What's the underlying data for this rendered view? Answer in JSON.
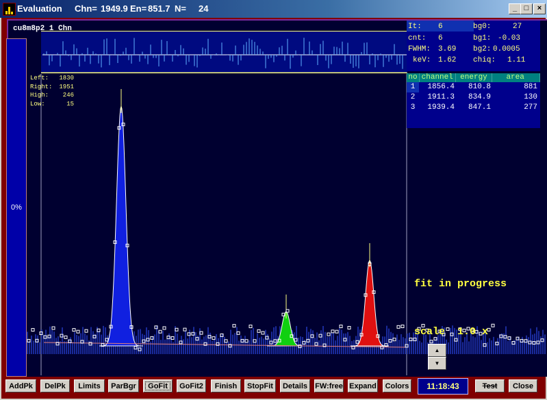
{
  "window": {
    "app_title": "Evaluation",
    "chn_label": "Chn=",
    "chn_value": "1949.9",
    "en_label": "En=",
    "en_value": "851.7",
    "n_label": "N=",
    "n_value": "24",
    "controls": {
      "minimize": "_",
      "maximize": "□",
      "close": "×"
    }
  },
  "spectrum": {
    "file_label": "cu8m8p2 1 Chn",
    "progress_text": "0%",
    "limits": [
      {
        "label": "Left:",
        "value": "1830"
      },
      {
        "label": "Right:",
        "value": "1951"
      },
      {
        "label": "High:",
        "value": "246"
      },
      {
        "label": "Low:",
        "value": "15"
      }
    ],
    "status": "fit in progress",
    "scale": "scale  1.0 x",
    "peak_colors": [
      "#1020e0",
      "#10d010",
      "#e01010"
    ]
  },
  "fit_params": {
    "it_label": "It:",
    "it_value": "6",
    "cnt_label": "cnt:",
    "cnt_value": "6",
    "fwhm_label": "FWHM:",
    "fwhm_value": "3.69",
    "kev_label": "keV:",
    "kev_value": "1.62",
    "bg0_label": "bg0:",
    "bg0_value": "27",
    "bg1_label": "bg1:",
    "bg1_value": "-0.03",
    "bg2_label": "bg2:",
    "bg2_value": "0.0005",
    "chiq_label": "chiq:",
    "chiq_value": "1.11"
  },
  "peak_table": {
    "headers": [
      "no",
      "channel",
      "energy",
      "area"
    ],
    "rows": [
      [
        "1",
        "1856.4",
        "810.8",
        "881"
      ],
      [
        "2",
        "1911.3",
        "834.9",
        "130"
      ],
      [
        "3",
        "1939.4",
        "847.1",
        "277"
      ]
    ]
  },
  "toolbar": {
    "buttons": [
      "AddPk",
      "DelPk",
      "Limits",
      "ParBgr",
      "GoFit",
      "GoFit2",
      "Finish",
      "StopFit",
      "Details",
      "FW:free",
      "Expand",
      "Colors",
      "Test",
      "Close"
    ],
    "clock": "11:18:43"
  },
  "spin": {
    "up": "▲",
    "down": "▼"
  }
}
